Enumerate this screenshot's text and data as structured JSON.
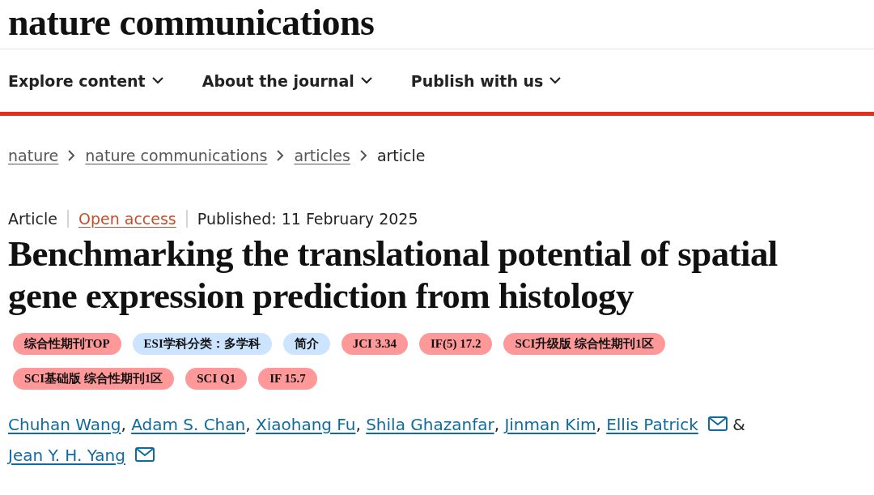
{
  "logo": "nature communications",
  "nav": [
    {
      "label": "Explore content"
    },
    {
      "label": "About the journal"
    },
    {
      "label": "Publish with us"
    }
  ],
  "breadcrumb": [
    {
      "label": "nature",
      "link": true
    },
    {
      "label": "nature communications",
      "link": true
    },
    {
      "label": "articles",
      "link": true
    },
    {
      "label": "article",
      "link": false
    }
  ],
  "meta": [
    {
      "label": "Article",
      "kind": "text"
    },
    {
      "label": "Open access",
      "kind": "link"
    },
    {
      "label": "Published: 11 February 2025",
      "kind": "text"
    }
  ],
  "title": "Benchmarking the translational potential of spatial gene expression prediction from histology",
  "tags": [
    {
      "label": "综合性期刊TOP",
      "color": "#ff9999"
    },
    {
      "label": "ESI学科分类：多学科",
      "color": "#cce4ff"
    },
    {
      "label": "简介",
      "color": "#cce4ff"
    },
    {
      "label": "JCI 3.34",
      "color": "#ff9999"
    },
    {
      "label": "IF(5) 17.2",
      "color": "#ff9999"
    },
    {
      "label": "SCI升级版 综合性期刊1区",
      "color": "#ff9999"
    },
    {
      "label": "SCI基础版 综合性期刊1区",
      "color": "#ff9999"
    },
    {
      "label": "SCI Q1",
      "color": "#ff9999"
    },
    {
      "label": "IF 15.7",
      "color": "#ff9999"
    }
  ],
  "authors": [
    {
      "name": "Chuhan Wang",
      "email": false,
      "separator": ","
    },
    {
      "name": "Adam S. Chan",
      "email": false,
      "separator": ","
    },
    {
      "name": "Xiaohang Fu",
      "email": false,
      "separator": ","
    },
    {
      "name": "Shila Ghazanfar",
      "email": false,
      "separator": ","
    },
    {
      "name": "Jinman Kim",
      "email": false,
      "separator": ","
    },
    {
      "name": "Ellis Patrick",
      "email": true,
      "separator": "&"
    },
    {
      "name": "Jean Y. H. Yang",
      "email": true
    }
  ]
}
